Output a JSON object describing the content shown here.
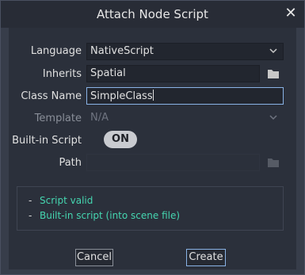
{
  "window": {
    "title": "Attach Node Script"
  },
  "form": {
    "language": {
      "label": "Language",
      "value": "NativeScript"
    },
    "inherits": {
      "label": "Inherits",
      "value": "Spatial"
    },
    "class_name": {
      "label": "Class Name",
      "value": "SimpleClass"
    },
    "template": {
      "label": "Template",
      "value": "N/A"
    },
    "builtin": {
      "label": "Built-in Script",
      "toggle": "ON"
    },
    "path": {
      "label": "Path",
      "value": ""
    }
  },
  "status": [
    {
      "bullet": "-",
      "text": "Script valid"
    },
    {
      "bullet": "-",
      "text": "Built-in script (into scene file)"
    }
  ],
  "buttons": {
    "cancel": "Cancel",
    "create": "Create"
  },
  "icons": {
    "close": "close-icon",
    "folder": "folder-icon",
    "dropdown": "chevron-down-icon"
  }
}
